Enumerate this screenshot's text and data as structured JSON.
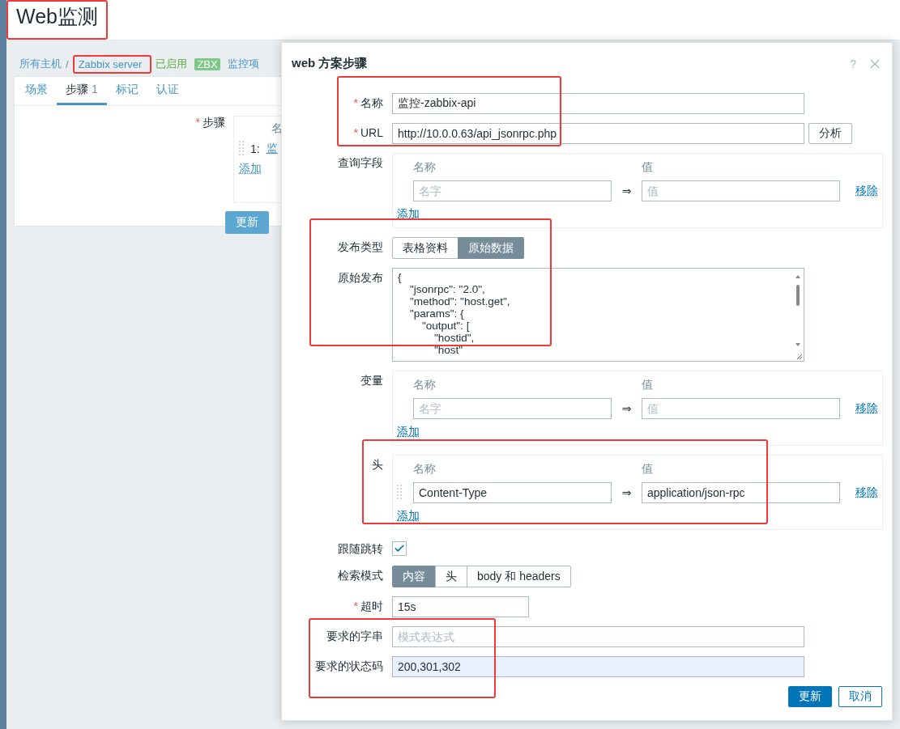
{
  "page": {
    "title": "Web监测",
    "breadcrumbs": [
      {
        "label": "所有主机",
        "kind": "link"
      },
      {
        "separator": "/",
        "label": "Zabbix server",
        "kind": "link"
      }
    ],
    "status": "已启用",
    "badge": "ZBX",
    "next_link": "监控项",
    "tabs": [
      {
        "label": "场景",
        "selected": false
      },
      {
        "label": "步骤",
        "count": "1",
        "selected": true
      },
      {
        "label": "标记",
        "selected": false
      },
      {
        "label": "认证",
        "selected": false
      }
    ],
    "steps": {
      "label": "步骤",
      "required_mark": "*",
      "column": "名",
      "row_number": "1:",
      "row_link": "监",
      "add": "添加"
    },
    "update_button": "更新"
  },
  "dialog": {
    "title": "web 方案步骤",
    "help": "?",
    "name": {
      "label": "名称",
      "required_mark": "*",
      "value": "监控-zabbix-api"
    },
    "url": {
      "label": "URL",
      "required_mark": "*",
      "value": "http://10.0.0.63/api_jsonrpc.php",
      "button": "分析"
    },
    "query_fields": {
      "label": "查询字段",
      "columns": [
        "名称",
        "值"
      ],
      "rows": [
        {
          "name": {
            "placeholder": "名字"
          },
          "arrow": "⇒",
          "value": {
            "placeholder": "值"
          },
          "remove": "移除"
        }
      ],
      "add": "添加"
    },
    "post_type": {
      "label": "发布类型",
      "options": [
        {
          "label": "表格资料",
          "selected": false
        },
        {
          "label": "原始数据",
          "selected": true
        }
      ]
    },
    "raw_post": {
      "label": "原始发布",
      "lines": [
        "{",
        "    \"jsonrpc\": \"2.0\",",
        "    \"method\": \"host.get\",",
        "    \"params\": {",
        "        \"output\": [",
        "            \"hostid\",",
        "            \"host\""
      ]
    },
    "variables": {
      "label": "变量",
      "columns": [
        "名称",
        "值"
      ],
      "rows": [
        {
          "name": {
            "placeholder": "名字"
          },
          "arrow": "⇒",
          "value": {
            "placeholder": "值"
          },
          "remove": "移除"
        }
      ],
      "add": "添加"
    },
    "headers": {
      "label": "头",
      "columns": [
        "名称",
        "值"
      ],
      "rows": [
        {
          "name": {
            "value": "Content-Type"
          },
          "arrow": "⇒",
          "value": {
            "value": "application/json-rpc"
          },
          "remove": "移除"
        }
      ],
      "add": "添加"
    },
    "follow_redirects": {
      "label": "跟随跳转",
      "checked": true
    },
    "retrieve_mode": {
      "label": "检索模式",
      "options": [
        {
          "label": "内容",
          "selected": true
        },
        {
          "label": "头",
          "selected": false
        },
        {
          "label": "body 和 headers",
          "selected": false
        }
      ]
    },
    "timeout": {
      "label": "超时",
      "required_mark": "*",
      "value": "15s"
    },
    "required_string": {
      "label": "要求的字串",
      "placeholder": "模式表达式"
    },
    "status_codes": {
      "label": "要求的状态码",
      "value": "200,301,302",
      "autofilled": true
    },
    "buttons": [
      {
        "label": "更新",
        "kind": "primary"
      },
      {
        "label": "取消",
        "kind": "secondary"
      }
    ]
  }
}
